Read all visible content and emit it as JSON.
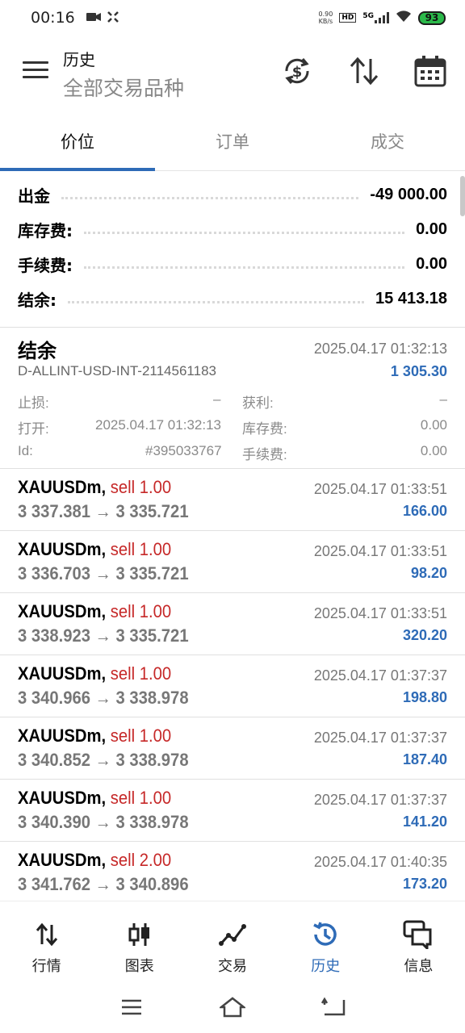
{
  "status": {
    "time": "00:16",
    "netspeed_value": "0.90",
    "netspeed_unit": "KB/s",
    "hd": "HD",
    "network": "5G",
    "battery": "93"
  },
  "appbar": {
    "title": "历史",
    "subtitle": "全部交易品种"
  },
  "tabs": [
    {
      "label": "价位"
    },
    {
      "label": "订单"
    },
    {
      "label": "成交"
    }
  ],
  "summary": [
    {
      "label": "出金",
      "value": "-49 000.00"
    },
    {
      "label": "库存费:",
      "value": "0.00"
    },
    {
      "label": "手续费:",
      "value": "0.00"
    },
    {
      "label": "结余:",
      "value": "15 413.18"
    }
  ],
  "balance": {
    "title": "结余",
    "time": "2025.04.17 01:32:13",
    "account": "D-ALLINT-USD-INT-2114561183",
    "amount": "1 305.30",
    "sl_label": "止损:",
    "sl_value": "–",
    "tp_label": "获利:",
    "tp_value": "–",
    "open_label": "打开:",
    "open_value": "2025.04.17 01:32:13",
    "swap_label": "库存费:",
    "swap_value": "0.00",
    "id_label": "Id:",
    "id_value": "#395033767",
    "fee_label": "手续费:",
    "fee_value": "0.00"
  },
  "trades": [
    {
      "symbol": "XAUUSDm,",
      "direction": "sell 1.00",
      "prices": "3 337.381 → 3 335.721",
      "time": "2025.04.17 01:33:51",
      "profit": "166.00"
    },
    {
      "symbol": "XAUUSDm,",
      "direction": "sell 1.00",
      "prices": "3 336.703 → 3 335.721",
      "time": "2025.04.17 01:33:51",
      "profit": "98.20"
    },
    {
      "symbol": "XAUUSDm,",
      "direction": "sell 1.00",
      "prices": "3 338.923 → 3 335.721",
      "time": "2025.04.17 01:33:51",
      "profit": "320.20"
    },
    {
      "symbol": "XAUUSDm,",
      "direction": "sell 1.00",
      "prices": "3 340.966 → 3 338.978",
      "time": "2025.04.17 01:37:37",
      "profit": "198.80"
    },
    {
      "symbol": "XAUUSDm,",
      "direction": "sell 1.00",
      "prices": "3 340.852 → 3 338.978",
      "time": "2025.04.17 01:37:37",
      "profit": "187.40"
    },
    {
      "symbol": "XAUUSDm,",
      "direction": "sell 1.00",
      "prices": "3 340.390 → 3 338.978",
      "time": "2025.04.17 01:37:37",
      "profit": "141.20"
    },
    {
      "symbol": "XAUUSDm,",
      "direction": "sell 2.00",
      "prices": "3 341.762 → 3 340.896",
      "time": "2025.04.17 01:40:35",
      "profit": "173.20"
    }
  ],
  "bottomnav": [
    {
      "label": "行情",
      "icon": "arrows-updown-icon"
    },
    {
      "label": "图表",
      "icon": "candlestick-icon"
    },
    {
      "label": "交易",
      "icon": "trade-line-icon"
    },
    {
      "label": "历史",
      "icon": "history-clock-icon"
    },
    {
      "label": "信息",
      "icon": "chat-bubbles-icon"
    }
  ],
  "colors": {
    "accent": "#2e6bb7",
    "sell": "#c62828",
    "muted": "#777777"
  }
}
